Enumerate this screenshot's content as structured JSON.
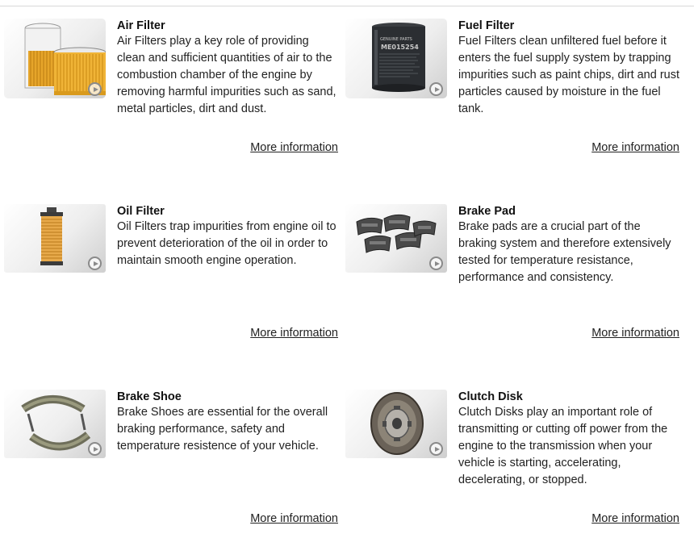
{
  "products": [
    {
      "title": "Air Filter",
      "description": "Air Filters play a key role of providing clean and sufficient quantities of air to the combustion chamber of the engine by removing harmful impurities such as sand, metal particles, dirt and dust.",
      "link_label": "More information",
      "image_icon": "air-filter-image"
    },
    {
      "title": "Fuel Filter",
      "description": "Fuel Filters clean unfiltered fuel before it enters the fuel supply system by trapping impurities such as paint chips, dirt and rust particles caused by moisture in the fuel tank.",
      "link_label": "More information",
      "image_icon": "fuel-filter-image",
      "image_text": "ME015254"
    },
    {
      "title": "Oil Filter",
      "description": "Oil Filters trap impurities from engine oil to prevent deterioration of the oil in order to maintain smooth engine operation.",
      "link_label": "More information",
      "image_icon": "oil-filter-image"
    },
    {
      "title": "Brake Pad",
      "description": "Brake pads are a crucial part of the braking system and therefore extensively tested for temperature resistance, performance and consistency.",
      "link_label": "More information",
      "image_icon": "brake-pad-image"
    },
    {
      "title": "Brake Shoe",
      "description": "Brake Shoes are essential for the overall braking performance, safety and temperature resistence of your vehicle.",
      "link_label": "More information",
      "image_icon": "brake-shoe-image"
    },
    {
      "title": "Clutch Disk",
      "description": "Clutch Disks play an important role of transmitting or cutting off power from the engine to the transmission when your vehicle is starting, accelerating, decelerating, or stopped.",
      "link_label": "More information",
      "image_icon": "clutch-disk-image"
    }
  ],
  "play_icon": "play-circle-icon"
}
